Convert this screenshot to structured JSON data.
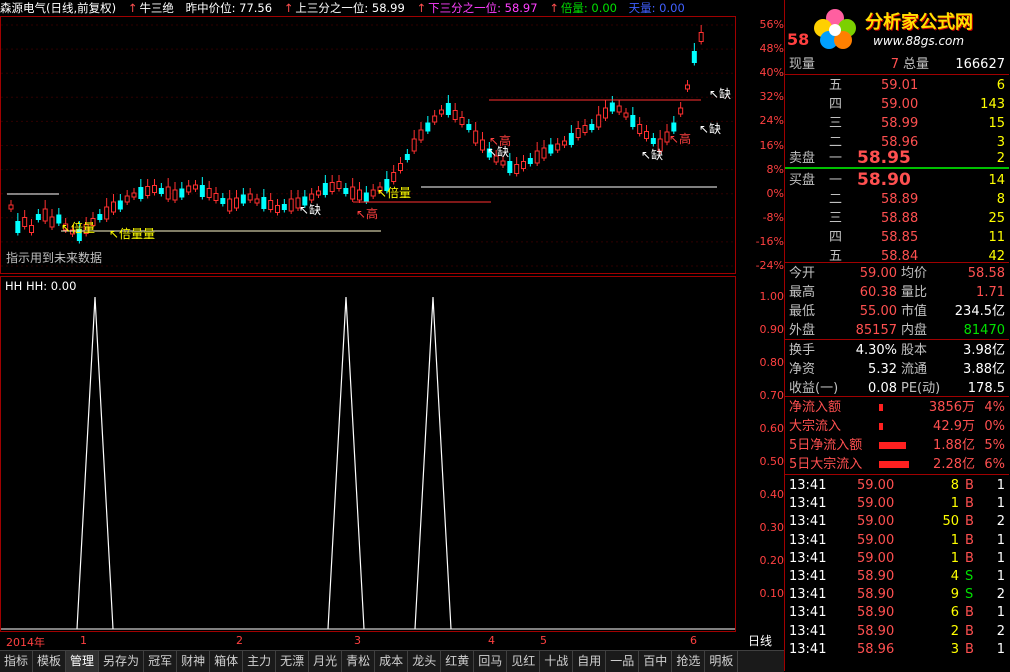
{
  "header": {
    "stock": "森源电气(日线,前复权)",
    "formula": "牛三绝",
    "mid_label": "昨中价位: 77.56",
    "upper_third": "上三分之一位: 58.99",
    "lower_third": "下三分之一位: 58.97",
    "times_vol": "倍量: 0.00",
    "shrink_vol": "天量: 0.00"
  },
  "main_chart": {
    "note": "指示用到未来数据",
    "labels": [
      "倍量",
      "倍量量",
      "倍量",
      "高",
      "缺",
      "缺",
      "高",
      "缺",
      "缺",
      "缺",
      "缺",
      "高"
    ],
    "y_ticks": [
      "56%",
      "48%",
      "40%",
      "32%",
      "24%",
      "16%",
      "8%",
      "0%",
      "-8%",
      "-16%",
      "-24%"
    ]
  },
  "indicator": {
    "title": "HH  HH: 0.00",
    "y_ticks": [
      "1.00",
      "0.90",
      "0.80",
      "0.70",
      "0.60",
      "0.50",
      "0.40",
      "0.30",
      "0.20",
      "0.10"
    ]
  },
  "x_axis": {
    "labels": [
      "2014年",
      "1",
      "2",
      "3",
      "4",
      "5",
      "6"
    ],
    "period": "日线"
  },
  "logo": {
    "text": "分析家公式网",
    "url": "www.88gs.com"
  },
  "quote": {
    "price_partial": "58",
    "now_label": "现量",
    "now_val": "7",
    "total_label": "总量",
    "total_val": "166627",
    "sell": [
      {
        "lvl": "五",
        "price": "59.01",
        "vol": "6"
      },
      {
        "lvl": "四",
        "price": "59.00",
        "vol": "143"
      },
      {
        "lvl": "三",
        "price": "58.99",
        "vol": "15"
      },
      {
        "lvl": "二",
        "price": "58.96",
        "vol": "3"
      },
      {
        "lvl": "一",
        "price": "58.95",
        "vol": "2"
      }
    ],
    "sell_label": "卖盘",
    "buy_label": "买盘",
    "buy": [
      {
        "lvl": "一",
        "price": "58.90",
        "vol": "14"
      },
      {
        "lvl": "二",
        "price": "58.89",
        "vol": "8"
      },
      {
        "lvl": "三",
        "price": "58.88",
        "vol": "25"
      },
      {
        "lvl": "四",
        "price": "58.85",
        "vol": "11"
      },
      {
        "lvl": "五",
        "price": "58.84",
        "vol": "42"
      }
    ],
    "stats": [
      {
        "l1": "今开",
        "v1": "59.00",
        "l2": "均价",
        "v2": "58.58"
      },
      {
        "l1": "最高",
        "v1": "60.38",
        "l2": "量比",
        "v2": "1.71"
      },
      {
        "l1": "最低",
        "v1": "55.00",
        "l2": "市值",
        "v2": "234.5亿"
      },
      {
        "l1": "外盘",
        "v1": "85157",
        "l2": "内盘",
        "v2": "81470"
      }
    ],
    "stats2": [
      {
        "l1": "换手",
        "v1": "4.30%",
        "l2": "股本",
        "v2": "3.98亿"
      },
      {
        "l1": "净资",
        "v1": "5.32",
        "l2": "流通",
        "v2": "3.88亿"
      },
      {
        "l1": "收益(一)",
        "v1": "0.08",
        "l2": "PE(动)",
        "v2": "178.5"
      }
    ],
    "flows": [
      {
        "label": "净流入额",
        "val": "3856万",
        "pct": "4%",
        "bar": 0.08
      },
      {
        "label": "大宗流入",
        "val": "42.9万",
        "pct": "0%",
        "bar": 0.02
      },
      {
        "label": "5日净流入额",
        "val": "1.88亿",
        "pct": "5%",
        "bar": 0.9
      },
      {
        "label": "5日大宗流入",
        "val": "2.28亿",
        "pct": "6%",
        "bar": 1.0
      }
    ],
    "ticks": [
      {
        "t": "13:41",
        "p": "59.00",
        "v": "8",
        "s": "B",
        "n": "1"
      },
      {
        "t": "13:41",
        "p": "59.00",
        "v": "1",
        "s": "B",
        "n": "1"
      },
      {
        "t": "13:41",
        "p": "59.00",
        "v": "50",
        "s": "B",
        "n": "2"
      },
      {
        "t": "13:41",
        "p": "59.00",
        "v": "1",
        "s": "B",
        "n": "1"
      },
      {
        "t": "13:41",
        "p": "59.00",
        "v": "1",
        "s": "B",
        "n": "1"
      },
      {
        "t": "13:41",
        "p": "58.90",
        "v": "4",
        "s": "S",
        "n": "1"
      },
      {
        "t": "13:41",
        "p": "58.90",
        "v": "9",
        "s": "S",
        "n": "2"
      },
      {
        "t": "13:41",
        "p": "58.90",
        "v": "6",
        "s": "B",
        "n": "1"
      },
      {
        "t": "13:41",
        "p": "58.90",
        "v": "2",
        "s": "B",
        "n": "2"
      },
      {
        "t": "13:41",
        "p": "58.96",
        "v": "3",
        "s": "B",
        "n": "1"
      }
    ]
  },
  "tabs": [
    "指标",
    "模板",
    "管理",
    "另存为",
    "冠军",
    "财神",
    "箱体",
    "主力",
    "无漂",
    "月光",
    "青松",
    "成本",
    "龙头",
    "红黄",
    "回马",
    "见红",
    "十战",
    "自用",
    "一品",
    "百中",
    "抢选",
    "明板"
  ],
  "active_tab": "管理"
}
